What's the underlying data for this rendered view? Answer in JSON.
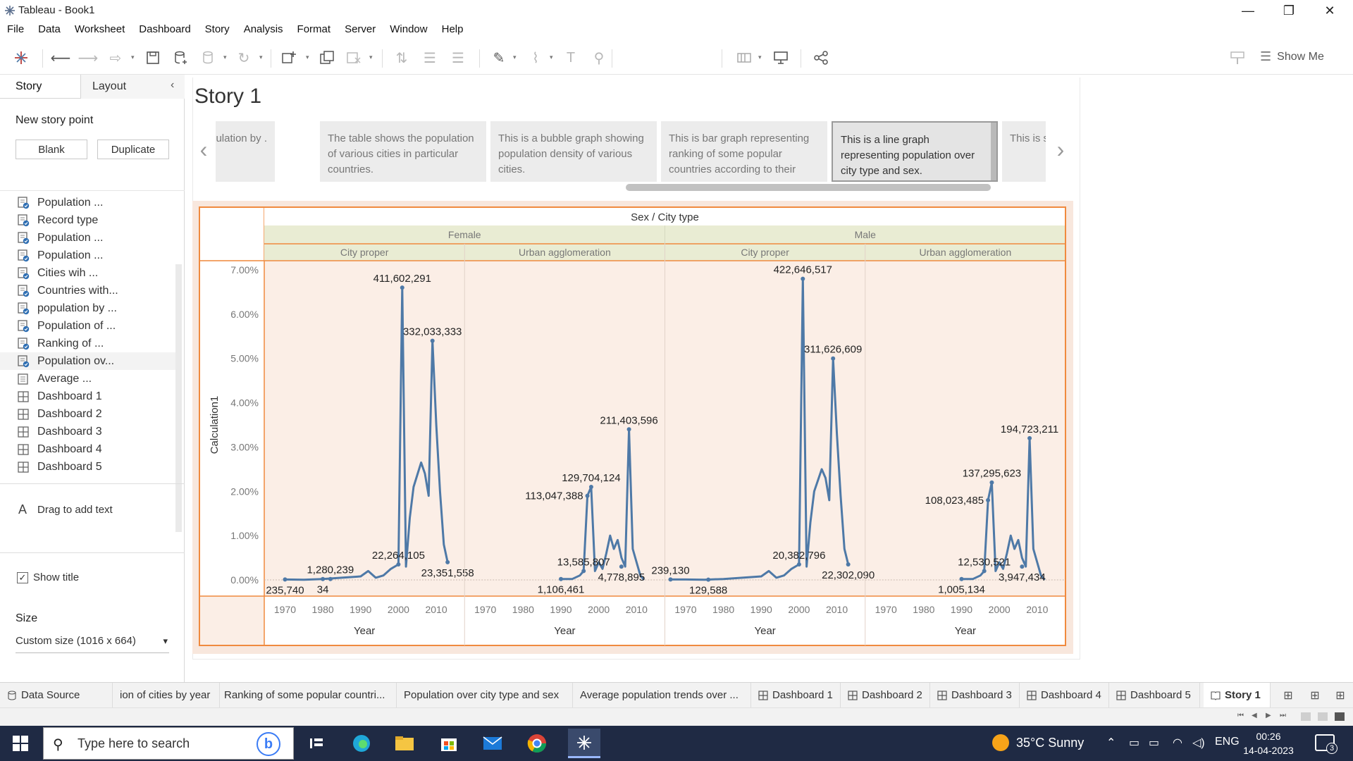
{
  "window": {
    "title": "Tableau - Book1",
    "controls": [
      "—",
      "❐",
      "✕"
    ]
  },
  "menu": [
    "File",
    "Data",
    "Worksheet",
    "Dashboard",
    "Story",
    "Analysis",
    "Format",
    "Server",
    "Window",
    "Help"
  ],
  "toolbar": {
    "show_me": "Show Me"
  },
  "left_pane": {
    "tabs": {
      "story": "Story",
      "layout": "Layout"
    },
    "new_story_point": "New story point",
    "blank": "Blank",
    "duplicate": "Duplicate",
    "sheets": [
      {
        "label": "Population ...",
        "type": "worksheet"
      },
      {
        "label": "Record type",
        "type": "worksheet"
      },
      {
        "label": "Population ...",
        "type": "worksheet"
      },
      {
        "label": "Population ...",
        "type": "worksheet"
      },
      {
        "label": "Cities wih ...",
        "type": "worksheet"
      },
      {
        "label": "Countries with...",
        "type": "worksheet"
      },
      {
        "label": "population by ...",
        "type": "worksheet"
      },
      {
        "label": "Population of ...",
        "type": "worksheet"
      },
      {
        "label": "Ranking of ...",
        "type": "worksheet"
      },
      {
        "label": "Population ov...",
        "type": "worksheet",
        "selected": true
      },
      {
        "label": "Average ...",
        "type": "worksheet-plain"
      },
      {
        "label": "Dashboard 1",
        "type": "dashboard"
      },
      {
        "label": "Dashboard 2",
        "type": "dashboard"
      },
      {
        "label": "Dashboard 3",
        "type": "dashboard"
      },
      {
        "label": "Dashboard 4",
        "type": "dashboard"
      },
      {
        "label": "Dashboard 5",
        "type": "dashboard"
      }
    ],
    "drag_text": "Drag to add text",
    "show_title": "Show title",
    "size_heading": "Size",
    "size_value": "Custom size (1016 x 664)"
  },
  "story": {
    "title": "Story 1",
    "points": [
      {
        "text": "chart g population by .",
        "active": false
      },
      {
        "text": "The table shows the population of various cities in particular countries.",
        "active": false
      },
      {
        "text": "This is a bubble graph showing population density of various cities.",
        "active": false
      },
      {
        "text": "This is bar graph representing ranking of some popular countries according to their",
        "active": false
      },
      {
        "text": "This is a line graph representing population over city type and sex.",
        "active": true
      },
      {
        "text": "This is showir type ar",
        "active": false
      }
    ]
  },
  "chart_data": {
    "type": "line",
    "header_title": "Sex / City type",
    "ylabel": "Calculation1",
    "xlabel": "Year",
    "ylim": [
      0,
      7
    ],
    "y_unit": "%",
    "y_ticks": [
      "0.00%",
      "1.00%",
      "2.00%",
      "3.00%",
      "4.00%",
      "5.00%",
      "6.00%",
      "7.00%"
    ],
    "x_ticks": [
      "1970",
      "1980",
      "1990",
      "2000",
      "2010"
    ],
    "xlim": [
      1966,
      2016
    ],
    "color": "#4e79a7",
    "groups": [
      {
        "name": "Female",
        "panels": [
          {
            "name": "City proper",
            "points": [
              [
                1970,
                0.01
              ],
              [
                1975,
                0.005
              ],
              [
                1980,
                0.02
              ],
              [
                1985,
                0.05
              ],
              [
                1990,
                0.08
              ],
              [
                1992,
                0.2
              ],
              [
                1994,
                0.05
              ],
              [
                1996,
                0.1
              ],
              [
                1998,
                0.25
              ],
              [
                2000,
                0.35
              ],
              [
                2001,
                6.6
              ],
              [
                2002,
                0.3
              ],
              [
                2003,
                1.4
              ],
              [
                2004,
                2.1
              ],
              [
                2006,
                2.65
              ],
              [
                2007,
                2.4
              ],
              [
                2008,
                1.9
              ],
              [
                2009,
                5.4
              ],
              [
                2010,
                3.5
              ],
              [
                2011,
                2.0
              ],
              [
                2012,
                0.8
              ],
              [
                2013,
                0.4
              ]
            ],
            "labels": [
              {
                "text": "411,602,291",
                "x": 2001,
                "y": 6.6,
                "pos": "above"
              },
              {
                "text": "332,033,333",
                "x": 2009,
                "y": 5.4,
                "pos": "above"
              },
              {
                "text": "22,264,105",
                "x": 2000,
                "y": 0.35,
                "pos": "above"
              },
              {
                "text": "1,280,239",
                "x": 1982,
                "y": 0.02,
                "pos": "above"
              },
              {
                "text": "23,351,558",
                "x": 2013,
                "y": 0.4,
                "pos": "below"
              },
              {
                "text": "235,740",
                "x": 1970,
                "y": 0.01,
                "pos": "below"
              },
              {
                "text": "34",
                "x": 1980,
                "y": 0.02,
                "pos": "below"
              }
            ]
          },
          {
            "name": "Urban agglomeration",
            "points": [
              [
                1990,
                0.02
              ],
              [
                1993,
                0.02
              ],
              [
                1995,
                0.1
              ],
              [
                1996,
                0.2
              ],
              [
                1997,
                1.9
              ],
              [
                1998,
                2.1
              ],
              [
                1999,
                0.2
              ],
              [
                2000,
                0.4
              ],
              [
                2001,
                0.25
              ],
              [
                2002,
                0.6
              ],
              [
                2003,
                1.0
              ],
              [
                2004,
                0.7
              ],
              [
                2005,
                0.9
              ],
              [
                2006,
                0.5
              ],
              [
                2007,
                0.3
              ],
              [
                2008,
                3.4
              ],
              [
                2009,
                0.7
              ],
              [
                2010,
                0.4
              ],
              [
                2011,
                0.1
              ],
              [
                2012,
                0.0
              ]
            ],
            "labels": [
              {
                "text": "211,403,596",
                "x": 2008,
                "y": 3.4,
                "pos": "above"
              },
              {
                "text": "129,704,124",
                "x": 1998,
                "y": 2.1,
                "pos": "above"
              },
              {
                "text": "113,047,388",
                "x": 1997,
                "y": 1.9,
                "pos": "left"
              },
              {
                "text": "13,585,807",
                "x": 1996,
                "y": 0.2,
                "pos": "above"
              },
              {
                "text": "1,106,461",
                "x": 1990,
                "y": 0.02,
                "pos": "below"
              },
              {
                "text": "4,778,895",
                "x": 2006,
                "y": 0.3,
                "pos": "below"
              }
            ]
          }
        ]
      },
      {
        "name": "Male",
        "panels": [
          {
            "name": "City proper",
            "points": [
              [
                1966,
                0.01
              ],
              [
                1970,
                0.01
              ],
              [
                1975,
                0.005
              ],
              [
                1980,
                0.02
              ],
              [
                1985,
                0.05
              ],
              [
                1990,
                0.08
              ],
              [
                1992,
                0.2
              ],
              [
                1994,
                0.05
              ],
              [
                1996,
                0.1
              ],
              [
                1998,
                0.25
              ],
              [
                2000,
                0.35
              ],
              [
                2001,
                6.8
              ],
              [
                2002,
                0.3
              ],
              [
                2003,
                1.3
              ],
              [
                2004,
                2.0
              ],
              [
                2006,
                2.5
              ],
              [
                2007,
                2.3
              ],
              [
                2008,
                1.8
              ],
              [
                2009,
                5.0
              ],
              [
                2010,
                3.3
              ],
              [
                2011,
                1.9
              ],
              [
                2012,
                0.7
              ],
              [
                2013,
                0.35
              ]
            ],
            "labels": [
              {
                "text": "422,646,517",
                "x": 2001,
                "y": 6.8,
                "pos": "above"
              },
              {
                "text": "311,626,609",
                "x": 2009,
                "y": 5.0,
                "pos": "above"
              },
              {
                "text": "20,382,796",
                "x": 2000,
                "y": 0.35,
                "pos": "above"
              },
              {
                "text": "239,130",
                "x": 1966,
                "y": 0.01,
                "pos": "above"
              },
              {
                "text": "22,302,090",
                "x": 2013,
                "y": 0.35,
                "pos": "below"
              },
              {
                "text": "129,588",
                "x": 1976,
                "y": 0.005,
                "pos": "below"
              }
            ]
          },
          {
            "name": "Urban agglomeration",
            "points": [
              [
                1990,
                0.02
              ],
              [
                1993,
                0.02
              ],
              [
                1995,
                0.1
              ],
              [
                1996,
                0.2
              ],
              [
                1997,
                1.8
              ],
              [
                1998,
                2.2
              ],
              [
                1999,
                0.2
              ],
              [
                2000,
                0.4
              ],
              [
                2001,
                0.25
              ],
              [
                2002,
                0.6
              ],
              [
                2003,
                1.0
              ],
              [
                2004,
                0.7
              ],
              [
                2005,
                0.9
              ],
              [
                2006,
                0.5
              ],
              [
                2007,
                0.3
              ],
              [
                2008,
                3.2
              ],
              [
                2009,
                0.7
              ],
              [
                2010,
                0.4
              ],
              [
                2011,
                0.1
              ],
              [
                2012,
                0.0
              ]
            ],
            "labels": [
              {
                "text": "194,723,211",
                "x": 2008,
                "y": 3.2,
                "pos": "above"
              },
              {
                "text": "137,295,623",
                "x": 1998,
                "y": 2.2,
                "pos": "above"
              },
              {
                "text": "108,023,485",
                "x": 1997,
                "y": 1.8,
                "pos": "left"
              },
              {
                "text": "12,530,521",
                "x": 1996,
                "y": 0.2,
                "pos": "above"
              },
              {
                "text": "1,005,134",
                "x": 1990,
                "y": 0.02,
                "pos": "below"
              },
              {
                "text": "3,947,434",
                "x": 2006,
                "y": 0.3,
                "pos": "below"
              }
            ]
          }
        ]
      }
    ]
  },
  "sheet_tabs": [
    {
      "label": "Data Source",
      "type": "datasource"
    },
    {
      "label": "ion of cities by year",
      "type": "plain"
    },
    {
      "label": "Ranking of some popular countri...",
      "type": "plain"
    },
    {
      "label": "Population over city type and sex",
      "type": "plain"
    },
    {
      "label": "Average population trends over ...",
      "type": "plain"
    },
    {
      "label": "Dashboard 1",
      "type": "dashboard"
    },
    {
      "label": "Dashboard 2",
      "type": "dashboard"
    },
    {
      "label": "Dashboard 3",
      "type": "dashboard"
    },
    {
      "label": "Dashboard 4",
      "type": "dashboard"
    },
    {
      "label": "Dashboard 5",
      "type": "dashboard"
    },
    {
      "label": "Story 1",
      "type": "story",
      "active": true
    }
  ],
  "taskbar": {
    "search_placeholder": "Type here to search",
    "weather": "35°C  Sunny",
    "lang": "ENG",
    "time": "00:26",
    "date": "14-04-2023",
    "notifications": "3"
  }
}
